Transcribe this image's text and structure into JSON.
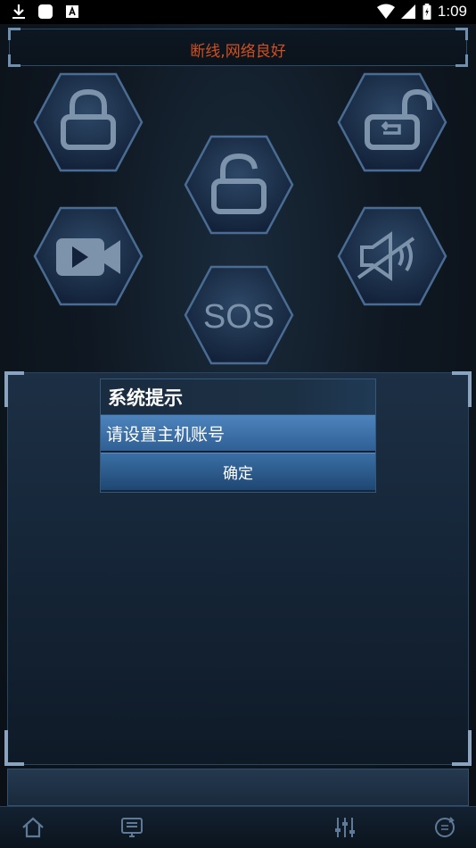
{
  "status_bar": {
    "time": "1:09",
    "left_icons": [
      "download-icon",
      "app-square-icon",
      "a-badge-icon"
    ],
    "right_icons": [
      "wifi-icon",
      "cell-signal-icon",
      "battery-icon"
    ]
  },
  "banner": {
    "text": "断线,网络良好",
    "text_color": "#d0501f"
  },
  "hex_buttons": [
    {
      "name": "lock-button",
      "icon": "lock-icon"
    },
    {
      "name": "unlock-return-button",
      "icon": "unlock-return-icon"
    },
    {
      "name": "unlock-button",
      "icon": "unlock-icon"
    },
    {
      "name": "video-button",
      "icon": "video-camera-icon"
    },
    {
      "name": "mute-button",
      "icon": "speaker-muted-icon"
    },
    {
      "name": "sos-button",
      "icon": "sos-icon",
      "label": "SOS"
    }
  ],
  "dialog": {
    "title": "系统提示",
    "message": "请设置主机账号",
    "confirm_label": "确定"
  },
  "nav": {
    "items": [
      "home-icon",
      "monitor-icon",
      "sliders-icon",
      "refresh-icon"
    ]
  }
}
